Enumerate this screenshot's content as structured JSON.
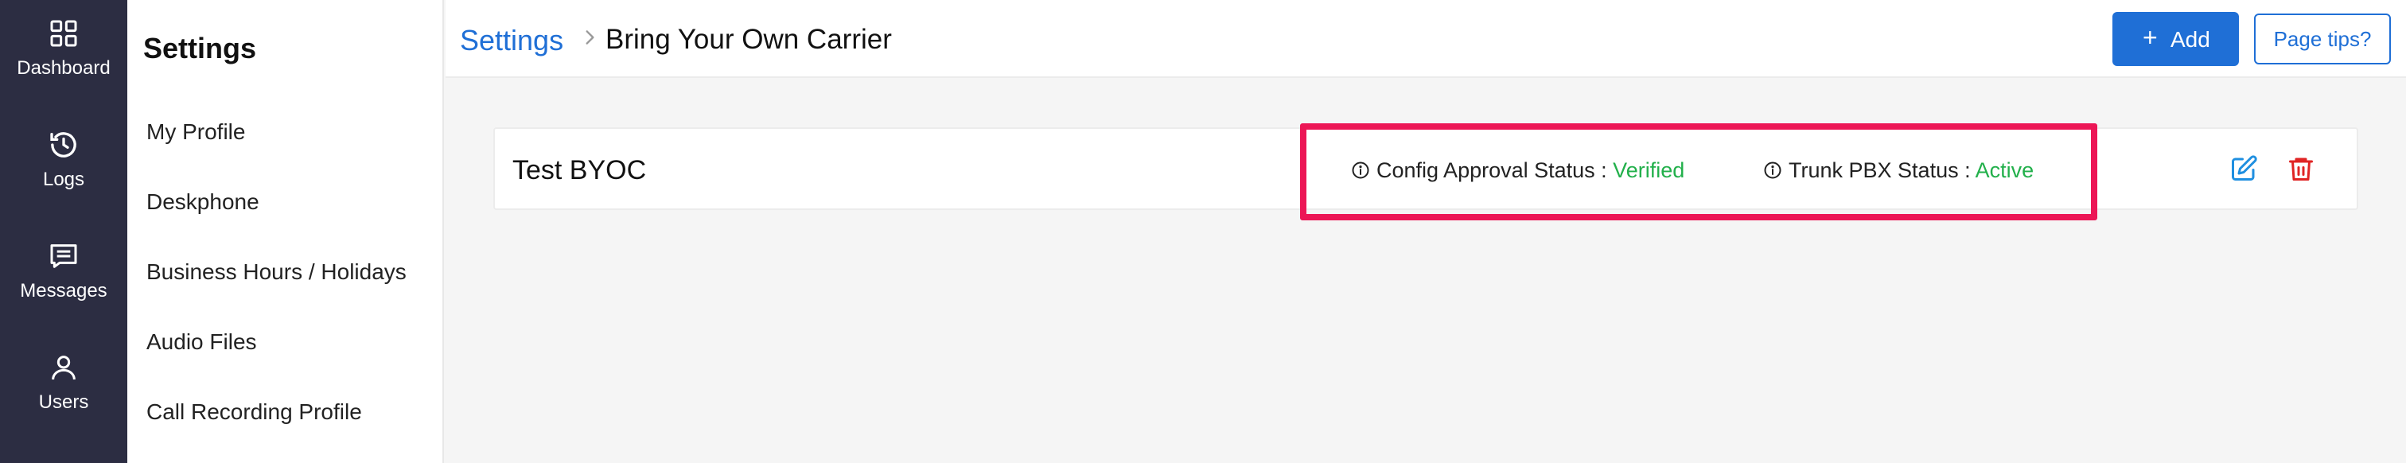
{
  "rail": {
    "items": [
      {
        "label": "Dashboard",
        "icon": "grid-icon"
      },
      {
        "label": "Logs",
        "icon": "history-icon"
      },
      {
        "label": "Messages",
        "icon": "message-icon"
      },
      {
        "label": "Users",
        "icon": "user-icon"
      }
    ]
  },
  "subnav": {
    "title": "Settings",
    "items": [
      "My Profile",
      "Deskphone",
      "Business Hours / Holidays",
      "Audio Files",
      "Call Recording Profile"
    ]
  },
  "header": {
    "breadcrumb_root": "Settings",
    "breadcrumb_current": "Bring Your Own Carrier",
    "add_plus": "+",
    "add_label": "Add",
    "tips_label": "Page tips?"
  },
  "carrier": {
    "name": "Test BYOC",
    "config_label": "Config Approval Status : ",
    "config_value": "Verified",
    "trunk_label": "Trunk PBX Status : ",
    "trunk_value": "Active"
  },
  "colors": {
    "rail_bg": "#2c2d42",
    "accent": "#1f6fd6",
    "success": "#22b04b",
    "danger": "#e02424",
    "highlight": "#ec1656"
  }
}
